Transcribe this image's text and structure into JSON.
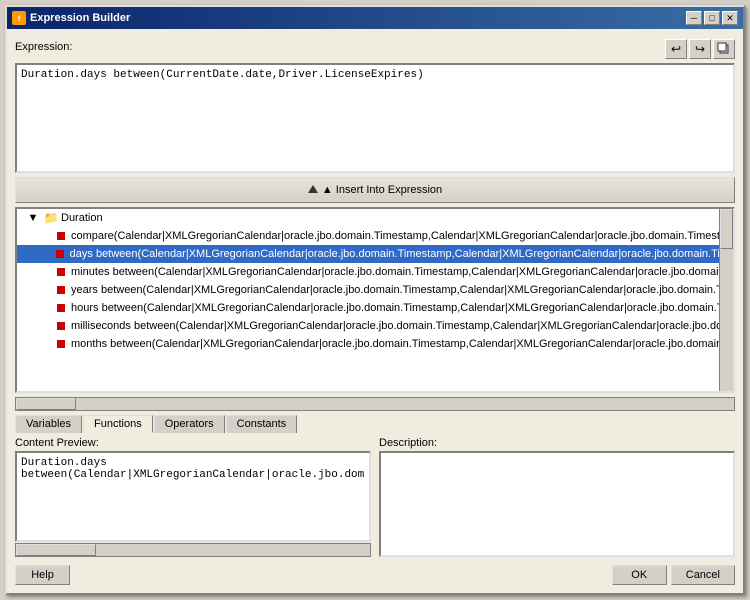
{
  "window": {
    "title": "Expression Builder",
    "icon": "fx"
  },
  "toolbar_buttons": [
    {
      "label": "↩",
      "name": "undo-btn"
    },
    {
      "label": "↪",
      "name": "redo-btn"
    },
    {
      "label": "□",
      "name": "copy-btn"
    }
  ],
  "insert_button_label": "▲  Insert Into Expression",
  "expression_label": "Expression:",
  "expression_value": "Duration.days between(CurrentDate.date,Driver.LicenseExpires)",
  "tree": {
    "root": {
      "label": "Duration",
      "expanded": true,
      "items": [
        "compare(Calendar|XMLGregorianCalendar|oracle.jbo.domain.Timestamp,Calendar|XMLGregorianCalendar|oracle.jbo.domain.Timesta",
        "days between(Calendar|XMLGregorianCalendar|oracle.jbo.domain.Timestamp,Calendar|XMLGregorianCalendar|oracle.jbo.domain.Tim",
        "minutes between(Calendar|XMLGregorianCalendar|oracle.jbo.domain.Timestamp,Calendar|XMLGregorianCalendar|oracle.jbo.domain.",
        "years between(Calendar|XMLGregorianCalendar|oracle.jbo.domain.Timestamp,Calendar|XMLGregorianCalendar|oracle.jbo.domain.Ti",
        "hours between(Calendar|XMLGregorianCalendar|oracle.jbo.domain.Timestamp,Calendar|XMLGregorianCalendar|oracle.jbo.domain.Ti",
        "milliseconds between(Calendar|XMLGregorianCalendar|oracle.jbo.domain.Timestamp,Calendar|XMLGregorianCalendar|oracle.jbo.do",
        "months between(Calendar|XMLGregorianCalendar|oracle.jbo.domain.Timestamp,Calendar|XMLGregorianCalendar|oracle.jbo.domain."
      ]
    }
  },
  "tabs": [
    {
      "label": "Variables",
      "active": false
    },
    {
      "label": "Functions",
      "active": true
    },
    {
      "label": "Operators",
      "active": false
    },
    {
      "label": "Constants",
      "active": false
    }
  ],
  "content_preview": {
    "label": "Content Preview:",
    "value": "Duration.days between(Calendar|XMLGregorianCalendar|oracle.jbo.dom"
  },
  "description": {
    "label": "Description:",
    "value": ""
  },
  "buttons": {
    "help": "Help",
    "ok": "OK",
    "cancel": "Cancel"
  }
}
